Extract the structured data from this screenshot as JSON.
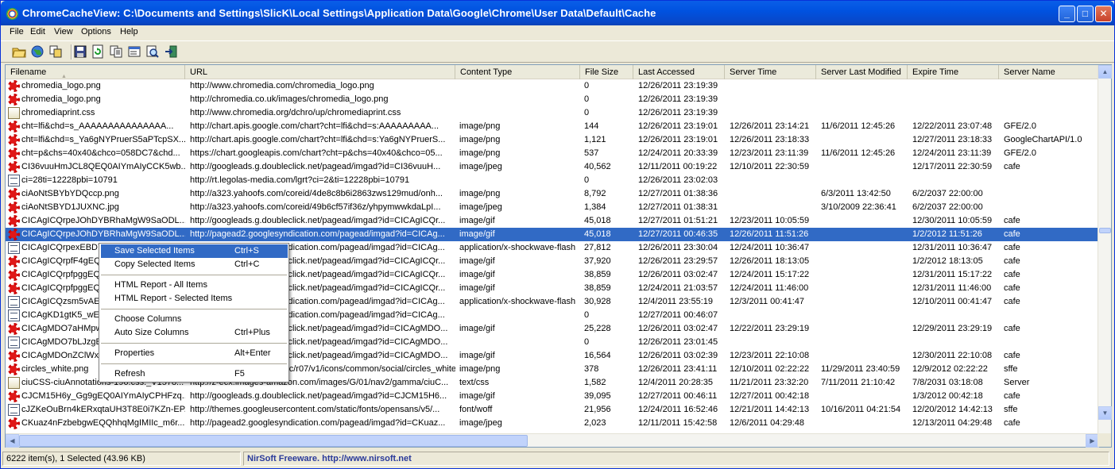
{
  "window": {
    "title": "ChromeCacheView:    C:\\Documents and Settings\\SlicK\\Local Settings\\Application Data\\Google\\Chrome\\User Data\\Default\\Cache",
    "minimize": "_",
    "maximize": "□",
    "close": "✕"
  },
  "menubar": [
    "File",
    "Edit",
    "View",
    "Options",
    "Help"
  ],
  "toolbar": [
    "open-folder-icon",
    "globe-icon",
    "copy-files-icon",
    "save-icon",
    "refresh-icon",
    "copy-icon",
    "properties-icon",
    "find-icon",
    "exit-icon"
  ],
  "columns": [
    "Filename",
    "URL",
    "Content Type",
    "File Size",
    "Last Accessed",
    "Server Time",
    "Server Last Modified",
    "Expire Time",
    "Server Name"
  ],
  "rows": [
    {
      "icon": "flash",
      "c": [
        "chromedia_logo.png",
        "http://www.chromedia.com/chromedia_logo.png",
        "",
        "0",
        "12/26/2011 23:19:39",
        "",
        "",
        "",
        ""
      ]
    },
    {
      "icon": "flash",
      "c": [
        "chromedia_logo.png",
        "http://chromedia.co.uk/images/chromedia_logo.png",
        "",
        "0",
        "12/26/2011 23:19:39",
        "",
        "",
        "",
        ""
      ]
    },
    {
      "icon": "css",
      "c": [
        "chromediaprint.css",
        "http://www.chromedia.org/dchro/up/chromediaprint.css",
        "",
        "0",
        "12/26/2011 23:19:39",
        "",
        "",
        "",
        ""
      ]
    },
    {
      "icon": "flash",
      "c": [
        "cht=lfi&chd=s_AAAAAAAAAAAAAAA...",
        "http://chart.apis.google.com/chart?cht=lfi&chd=s:AAAAAAAAA...",
        "image/png",
        "144",
        "12/26/2011 23:19:01",
        "12/26/2011 23:14:21",
        "11/6/2011 12:45:26",
        "12/22/2011 23:07:48",
        "GFE/2.0"
      ]
    },
    {
      "icon": "flash",
      "c": [
        "cht=lfi&chd=s_Ya6gNYPruerS5aPTcpSX...",
        "http://chart.apis.google.com/chart?cht=lfi&chd=s:Ya6gNYPruerS...",
        "image/png",
        "1,121",
        "12/26/2011 23:19:01",
        "12/26/2011 23:18:33",
        "",
        "12/27/2011 23:18:33",
        "GoogleChartAPI/1.0"
      ]
    },
    {
      "icon": "flash",
      "c": [
        "cht=p&chs=40x40&chco=058DC7&chd...",
        "https://chart.googleapis.com/chart?cht=p&chs=40x40&chco=05...",
        "image/png",
        "537",
        "12/24/2011 20:33:39",
        "12/23/2011 23:11:39",
        "11/6/2011 12:45:26",
        "12/24/2011 23:11:39",
        "GFE/2.0"
      ]
    },
    {
      "icon": "flash",
      "c": [
        "CI36vuuHmJCL8QEQ0AIYmAIyCCK5wb...",
        "http://googleads.g.doubleclick.net/pagead/imgad?id=CI36vuuH...",
        "image/jpeg",
        "40,562",
        "12/11/2011 00:19:22",
        "12/10/2011 22:30:59",
        "",
        "12/17/2011 22:30:59",
        "cafe"
      ]
    },
    {
      "icon": "doc",
      "c": [
        "ci=28ti=12228pbi=10791",
        "http://rt.legolas-media.com/lgrt?ci=2&ti=12228pbi=10791",
        "",
        "0",
        "12/26/2011 23:02:03",
        "",
        "",
        "",
        ""
      ]
    },
    {
      "icon": "flash",
      "c": [
        "ciAoNtSBYbYDQccp.png",
        "http://a323.yahoofs.com/coreid/4de8c8b6i2863zws129mud/onh...",
        "image/png",
        "8,792",
        "12/27/2011 01:38:36",
        "",
        "6/3/2011 13:42:50",
        "6/2/2037 22:00:00",
        ""
      ]
    },
    {
      "icon": "flash",
      "c": [
        "ciAoNtSBYD1JUXNC.jpg",
        "http://a323.yahoofs.com/coreid/49b6cf57if36z/yhpymwwkdaLpI...",
        "image/jpeg",
        "1,384",
        "12/27/2011 01:38:31",
        "",
        "3/10/2009 22:36:41",
        "6/2/2037 22:00:00",
        ""
      ]
    },
    {
      "icon": "flash",
      "c": [
        "CICAgICQrpeJOhDYBRhaMgW9SaODL...",
        "http://googleads.g.doubleclick.net/pagead/imgad?id=CICAgICQr...",
        "image/gif",
        "45,018",
        "12/27/2011 01:51:21",
        "12/23/2011 10:05:59",
        "",
        "12/30/2011 10:05:59",
        "cafe"
      ]
    },
    {
      "icon": "flash",
      "sel": true,
      "c": [
        "CICAgICQrpeJOhDYBRhaMgW9SaODL...",
        "http://pagead2.googlesyndication.com/pagead/imgad?id=CICAg...",
        "image/gif",
        "45,018",
        "12/27/2011 00:46:35",
        "12/26/2011 11:51:26",
        "",
        "1/2/2012 11:51:26",
        "cafe"
      ]
    },
    {
      "icon": "doc",
      "c": [
        "CICAgICQrpexEBDY",
        "http://pagead2.googlesyndication.com/pagead/imgad?id=CICAg...",
        "application/x-shockwave-flash",
        "27,812",
        "12/26/2011 23:30:04",
        "12/24/2011 10:36:47",
        "",
        "12/31/2011 10:36:47",
        "cafe"
      ]
    },
    {
      "icon": "flash",
      "c": [
        "CICAgICQrpfF4gEQ",
        "http://googleads.g.doubleclick.net/pagead/imgad?id=CICAgICQr...",
        "image/gif",
        "37,920",
        "12/26/2011 23:29:57",
        "12/26/2011 18:13:05",
        "",
        "1/2/2012 18:13:05",
        "cafe"
      ]
    },
    {
      "icon": "flash",
      "c": [
        "CICAgICQrpfpggEQ",
        "http://googleads.g.doubleclick.net/pagead/imgad?id=CICAgICQr...",
        "image/gif",
        "38,859",
        "12/26/2011 03:02:47",
        "12/24/2011 15:17:22",
        "",
        "12/31/2011 15:17:22",
        "cafe"
      ]
    },
    {
      "icon": "flash",
      "c": [
        "CICAgICQrpfpggEQ",
        "http://googleads.g.doubleclick.net/pagead/imgad?id=CICAgICQr...",
        "image/gif",
        "38,859",
        "12/24/2011 21:03:57",
        "12/24/2011 11:46:00",
        "",
        "12/31/2011 11:46:00",
        "cafe"
      ]
    },
    {
      "icon": "doc",
      "c": [
        "CICAgICQzsm5vAEC",
        "http://pagead2.googlesyndication.com/pagead/imgad?id=CICAg...",
        "application/x-shockwave-flash",
        "30,928",
        "12/4/2011 23:55:19",
        "12/3/2011 00:41:47",
        "",
        "12/10/2011 00:41:47",
        "cafe"
      ]
    },
    {
      "icon": "doc",
      "c": [
        "CICAgKD1gtK5_wEC",
        "http://pagead2.googlesyndication.com/pagead/imgad?id=CICAg...",
        "",
        "0",
        "12/27/2011 00:46:07",
        "",
        "",
        "",
        ""
      ]
    },
    {
      "icon": "flash",
      "c": [
        "CICAgMDO7aHMpwI",
        "http://googleads.g.doubleclick.net/pagead/imgad?id=CICAgMDO...",
        "image/gif",
        "25,228",
        "12/26/2011 03:02:47",
        "12/22/2011 23:29:19",
        "",
        "12/29/2011 23:29:19",
        "cafe"
      ]
    },
    {
      "icon": "doc",
      "c": [
        "CICAgMDO7bLJzgE",
        "http://googleads.g.doubleclick.net/pagead/imgad?id=CICAgMDO...",
        "",
        "0",
        "12/26/2011 23:01:45",
        "",
        "",
        "",
        ""
      ]
    },
    {
      "icon": "flash",
      "c": [
        "CICAgMDOnZClWxC",
        "http://googleads.g.doubleclick.net/pagead/imgad?id=CICAgMDO...",
        "image/gif",
        "16,564",
        "12/26/2011 03:02:39",
        "12/23/2011 22:10:08",
        "",
        "12/30/2011 22:10:08",
        "cafe"
      ]
    },
    {
      "icon": "flash",
      "c": [
        "circles_white.png",
        "http://s7.addthis.com/static/r07/v1/icons/common/social/circles_white.png",
        "image/png",
        "378",
        "12/26/2011 23:41:11",
        "12/10/2011 02:22:22",
        "11/29/2011 23:40:59",
        "12/9/2012 02:22:22",
        "sffe"
      ]
    },
    {
      "icon": "css",
      "c": [
        "ciuCSS-ciuAnnotations-196.css._V1578...",
        "http://z-ecx.images-amazon.com/images/G/01/nav2/gamma/ciuC...",
        "text/css",
        "1,582",
        "12/4/2011 20:28:35",
        "11/21/2011 23:32:20",
        "7/11/2011 21:10:42",
        "7/8/2031 03:18:08",
        "Server"
      ]
    },
    {
      "icon": "flash",
      "c": [
        "CJCM15H6y_Gg9gEQ0AIYmAIyCPHFzq...",
        "http://googleads.g.doubleclick.net/pagead/imgad?id=CJCM15H6...",
        "image/gif",
        "39,095",
        "12/27/2011 00:46:11",
        "12/27/2011 00:42:18",
        "",
        "1/3/2012 00:42:18",
        "cafe"
      ]
    },
    {
      "icon": "doc",
      "c": [
        "cJZKeOuBrn4kERxqtaUH3T8E0i7KZn-EP...",
        "http://themes.googleusercontent.com/static/fonts/opensans/v5/...",
        "font/woff",
        "21,956",
        "12/24/2011 16:52:46",
        "12/21/2011 14:42:13",
        "10/16/2011 04:21:54",
        "12/20/2012 14:42:13",
        "sffe"
      ]
    },
    {
      "icon": "flash",
      "c": [
        "CKuaz4nFzbebgwEQQhhqMgIMIIc_m6r...",
        "http://pagead2.googlesyndication.com/pagead/imgad?id=CKuaz...",
        "image/jpeg",
        "2,023",
        "12/11/2011 15:42:58",
        "12/6/2011 04:29:48",
        "",
        "12/13/2011 04:29:48",
        "cafe"
      ]
    }
  ],
  "context_menu": [
    {
      "label": "Save Selected Items",
      "shortcut": "Ctrl+S",
      "highlighted": true
    },
    {
      "label": "Copy Selected Items",
      "shortcut": "Ctrl+C"
    },
    {
      "label": "HTML Report - All Items",
      "shortcut": ""
    },
    {
      "label": "HTML Report - Selected Items",
      "shortcut": ""
    },
    {
      "label": "Choose Columns",
      "shortcut": ""
    },
    {
      "label": "Auto Size Columns",
      "shortcut": "Ctrl+Plus"
    },
    {
      "label": "Properties",
      "shortcut": "Alt+Enter"
    },
    {
      "label": "Refresh",
      "shortcut": "F5"
    }
  ],
  "status": {
    "count": "6222 item(s), 1 Selected  (43.96 KB)",
    "freeware": "NirSoft Freeware.  http://www.nirsoft.net"
  },
  "colors": {
    "selection": "#316ac5",
    "titlebar": "#0a5ee8"
  }
}
